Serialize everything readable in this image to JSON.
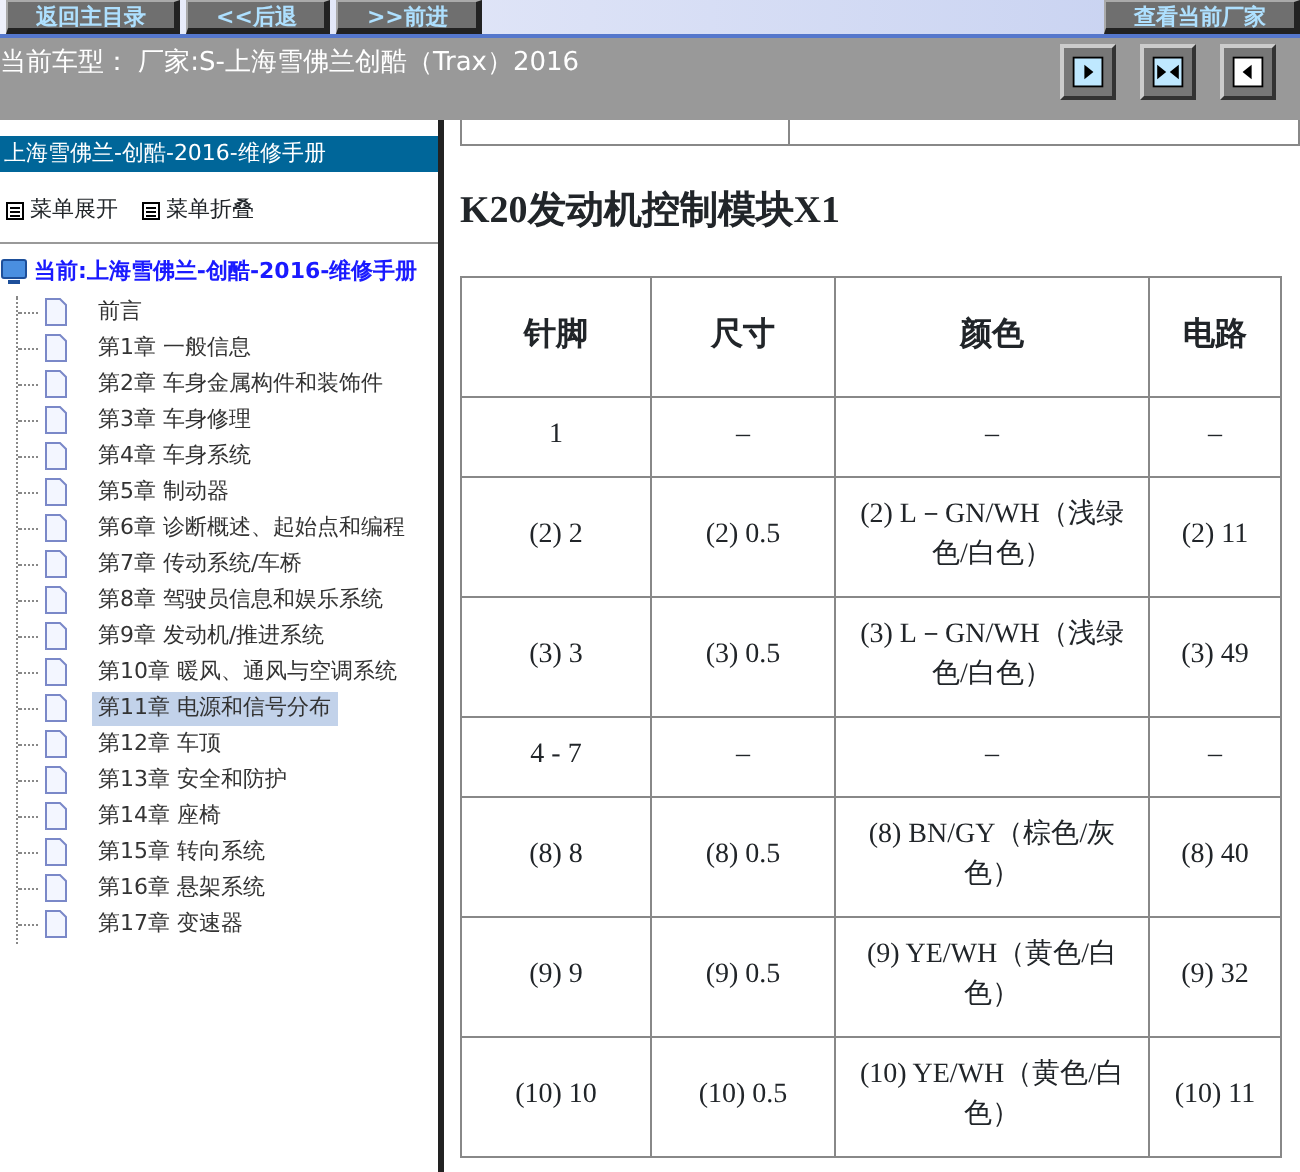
{
  "top_buttons": [
    "返回主目录",
    "<<后退",
    ">>前进",
    "查看当前厂家"
  ],
  "model_bar": {
    "text": "当前车型：  厂家:S-上海雪佛兰创酷（Trax）2016"
  },
  "sidebar": {
    "title": "上海雪佛兰-创酷-2016-维修手册",
    "controls": [
      "菜单展开",
      "菜单折叠"
    ],
    "root": {
      "label": "当前:上海雪佛兰-创酷-2016-维修手册",
      "children": [
        {
          "label": "前言",
          "selected": false
        },
        {
          "label": "第1章 一般信息",
          "selected": false
        },
        {
          "label": "第2章 车身金属构件和装饰件",
          "selected": false
        },
        {
          "label": "第3章 车身修理",
          "selected": false
        },
        {
          "label": "第4章 车身系统",
          "selected": false
        },
        {
          "label": "第5章 制动器",
          "selected": false
        },
        {
          "label": "第6章 诊断概述、起始点和编程",
          "selected": false
        },
        {
          "label": "第7章 传动系统/车桥",
          "selected": false
        },
        {
          "label": "第8章 驾驶员信息和娱乐系统",
          "selected": false
        },
        {
          "label": "第9章 发动机/推进系统",
          "selected": false
        },
        {
          "label": "第10章 暖风、通风与空调系统",
          "selected": false
        },
        {
          "label": "第11章 电源和信号分布",
          "selected": true
        },
        {
          "label": "第12章 车顶",
          "selected": false
        },
        {
          "label": "第13章 安全和防护",
          "selected": false
        },
        {
          "label": "第14章 座椅",
          "selected": false
        },
        {
          "label": "第15章 转向系统",
          "selected": false
        },
        {
          "label": "第16章 悬架系统",
          "selected": false
        },
        {
          "label": "第17章 变速器",
          "selected": false
        }
      ]
    }
  },
  "content": {
    "heading": "K20发动机控制模块X1",
    "table": {
      "columns": [
        "针脚",
        "尺寸",
        "颜色",
        "电路"
      ],
      "rows": [
        [
          "1",
          "–",
          "–",
          "–"
        ],
        [
          "(2) 2",
          "(2) 0.5",
          "(2) L－GN/WH（浅绿色/白色）",
          "(2) 11"
        ],
        [
          "(3) 3",
          "(3) 0.5",
          "(3) L－GN/WH（浅绿色/白色）",
          "(3) 49"
        ],
        [
          "4 - 7",
          "–",
          "–",
          "–"
        ],
        [
          "(8) 8",
          "(8) 0.5",
          "(8) BN/GY（棕色/灰色）",
          "(8) 40"
        ],
        [
          "(9) 9",
          "(9) 0.5",
          "(9) YE/WH（黄色/白色）",
          "(9) 32"
        ],
        [
          "(10) 10",
          "(10) 0.5",
          "(10) YE/WH（黄色/白色）",
          "(10) 11"
        ]
      ]
    }
  }
}
